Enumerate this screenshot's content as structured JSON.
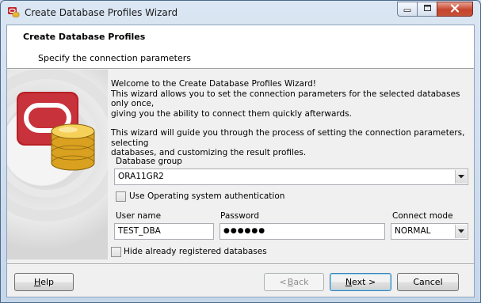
{
  "window": {
    "title": "Create Database Profiles Wizard"
  },
  "header": {
    "title": "Create Database Profiles",
    "subtitle": "Specify the connection parameters"
  },
  "intro": {
    "line1": "Welcome to the Create Database Profiles Wizard!",
    "line2": "This wizard allows you to set the connection parameters for the selected databases only once,",
    "line3": "giving you the ability to connect them quickly afterwards.",
    "line4": "This wizard will guide you through the process of setting the connection parameters, selecting",
    "line5": "databases, and customizing the result profiles."
  },
  "form": {
    "database_group_label": "Database group",
    "database_group_value": "ORA11GR2",
    "os_auth_label": "Use Operating system authentication",
    "os_auth_checked": false,
    "username_label": "User name",
    "username_value": "TEST_DBA",
    "password_label": "Password",
    "password_mask": "●●●●●●",
    "connect_mode_label": "Connect mode",
    "connect_mode_value": "NORMAL",
    "hide_registered_label": "Hide already registered databases",
    "hide_registered_checked": false
  },
  "buttons": {
    "help_first": "H",
    "help_rest": "elp",
    "back_lt": "< ",
    "back_first": "B",
    "back_rest": "ack",
    "next_first": "N",
    "next_rest": "ext >",
    "cancel": "Cancel"
  },
  "icons": {
    "app": "database-wizard-icon",
    "art": "oracle-database-coins-graphic",
    "minimize": "minimize-icon",
    "maximize": "maximize-icon",
    "close": "close-icon",
    "dropdown": "chevron-down-icon"
  },
  "colors": {
    "oracle_red": "#c0262c",
    "coin_gold": "#e8b42a"
  }
}
